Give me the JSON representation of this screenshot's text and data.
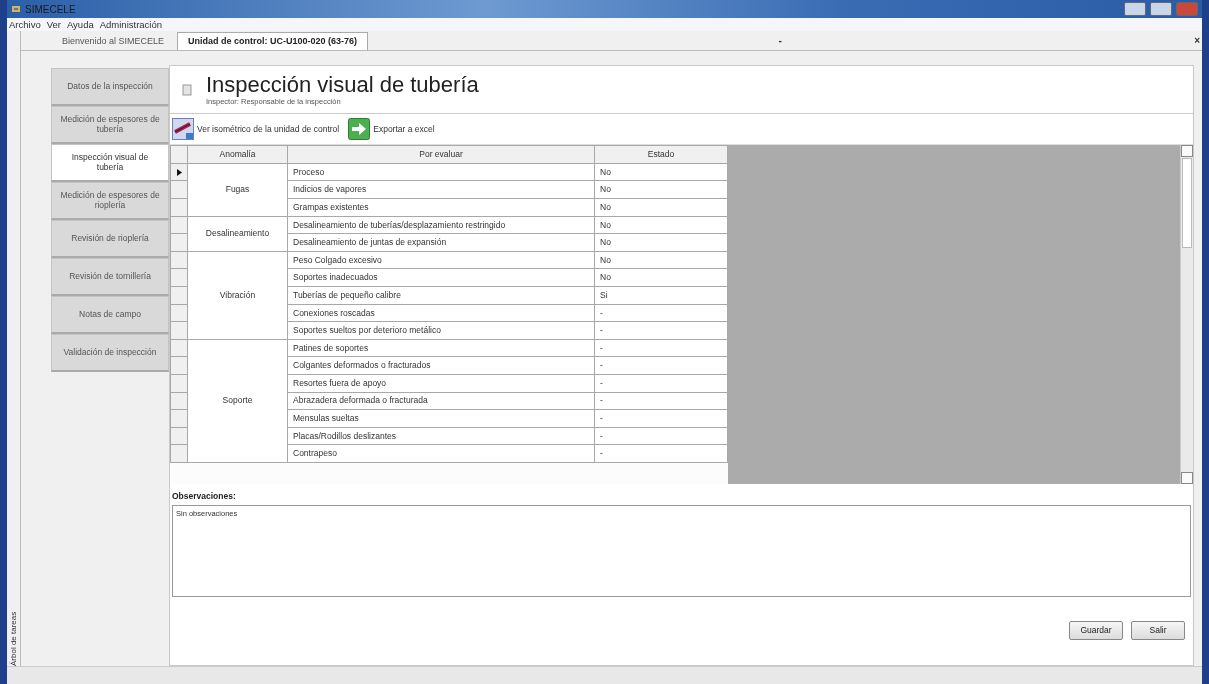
{
  "window": {
    "title": "SIMECELE"
  },
  "menu": [
    "Archivo",
    "Ver",
    "Ayuda",
    "Administración"
  ],
  "side_strip": {
    "label": "Árbol de tareas"
  },
  "tabs": [
    {
      "label": "Bienvenido al SIMECELE",
      "selected": false
    },
    {
      "label": "Unidad de control: UC-U100-020 (63-76)",
      "selected": true
    }
  ],
  "tab_controls": [
    "-",
    "×"
  ],
  "nav": [
    {
      "label": "Datos de la inspección",
      "selected": false
    },
    {
      "label": "Medición de espesores de tubería",
      "selected": false
    },
    {
      "label": "Inspección visual de tubería",
      "selected": true
    },
    {
      "label": "Medición de espesores de rioplería",
      "selected": false
    },
    {
      "label": "Revisión de rioplería",
      "selected": false
    },
    {
      "label": "Revisión de tornillería",
      "selected": false
    },
    {
      "label": "Notas de campo",
      "selected": false
    },
    {
      "label": "Validación de inspección",
      "selected": false
    }
  ],
  "header": {
    "title": "Inspección visual de tubería",
    "subtitle": "Inspector: Responsable de la inspección"
  },
  "toolbar": [
    {
      "kind": "isometric",
      "label": "Ver isométrico de la unidad de control"
    },
    {
      "kind": "export",
      "label": "Exportar a excel"
    }
  ],
  "table": {
    "columns": [
      "Anomalía",
      "Por evaluar",
      "Estado"
    ],
    "groups": [
      {
        "anomaly": "Fugas",
        "rows": [
          {
            "item": "Proceso",
            "status": "No",
            "current": true
          },
          {
            "item": "Indicios de vapores",
            "status": "No",
            "current": false
          },
          {
            "item": "Grampas existentes",
            "status": "No",
            "current": false
          }
        ]
      },
      {
        "anomaly": "Desalineamiento",
        "rows": [
          {
            "item": "Desalineamiento de tuberías/desplazamiento restringido",
            "status": "No",
            "current": false
          },
          {
            "item": "Desalineamiento de juntas de expansión",
            "status": "No",
            "current": false
          }
        ]
      },
      {
        "anomaly": "Vibración",
        "rows": [
          {
            "item": "Peso Colgado excesivo",
            "status": "No",
            "current": false
          },
          {
            "item": "Soportes inadecuados",
            "status": "No",
            "current": false
          },
          {
            "item": "Tuberías de pequeño calibre",
            "status": "Si",
            "current": false
          },
          {
            "item": "Conexiones roscadas",
            "status": "-",
            "current": false
          },
          {
            "item": "Soportes sueltos por deterioro metálico",
            "status": "-",
            "current": false
          }
        ]
      },
      {
        "anomaly": "Soporte",
        "rows": [
          {
            "item": "Patines de soportes",
            "status": "-",
            "current": false
          },
          {
            "item": "Colgantes deformados o fracturados",
            "status": "-",
            "current": false
          },
          {
            "item": "Resortes fuera de apoyo",
            "status": "-",
            "current": false
          },
          {
            "item": "Abrazadera deformada o fracturada",
            "status": "-",
            "current": false
          },
          {
            "item": "Mensulas sueltas",
            "status": "-",
            "current": false
          },
          {
            "item": "Placas/Rodillos deslizantes",
            "status": "-",
            "current": false
          },
          {
            "item": "Contrapeso",
            "status": "-",
            "current": false
          }
        ]
      }
    ]
  },
  "observations": {
    "label": "Observaciones:",
    "value": "Sin observaciones"
  },
  "buttons": [
    "Guardar",
    "Salir"
  ]
}
